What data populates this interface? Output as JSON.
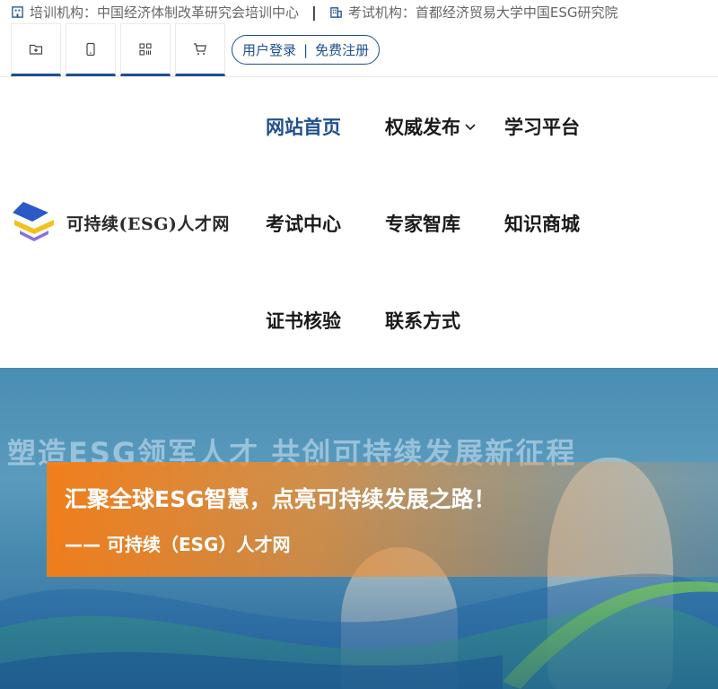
{
  "topbar": {
    "training_org": "培训机构：中国经济体制改革研究会培训中心",
    "separator": "|",
    "exam_org": "考试机构：首都经济贸易大学中国ESG研究院"
  },
  "toolbar": {
    "icons": [
      "add-folder-icon",
      "mobile-icon",
      "qrcode-icon",
      "cart-icon"
    ],
    "login_label": "用户登录",
    "login_separator": "|",
    "register_label": "免费注册"
  },
  "logo": {
    "text": "可持续(ESG)人才网"
  },
  "nav": {
    "items": [
      {
        "label": "网站首页",
        "active": true
      },
      {
        "label": "权威发布",
        "has_dropdown": true
      },
      {
        "label": "学习平台"
      },
      {
        "label": "考试中心"
      },
      {
        "label": "专家智库"
      },
      {
        "label": "知识商城"
      },
      {
        "label": "证书核验"
      },
      {
        "label": "联系方式"
      }
    ]
  },
  "banner": {
    "background_title": "塑造ESG领军人才 共创可持续发展新征程",
    "headline": "汇聚全球ESG智慧，点亮可持续发展之路！",
    "subline": "—— 可持续（ESG）人才网"
  },
  "colors": {
    "brand": "#1f4f8f",
    "accent": "#f87d14"
  }
}
